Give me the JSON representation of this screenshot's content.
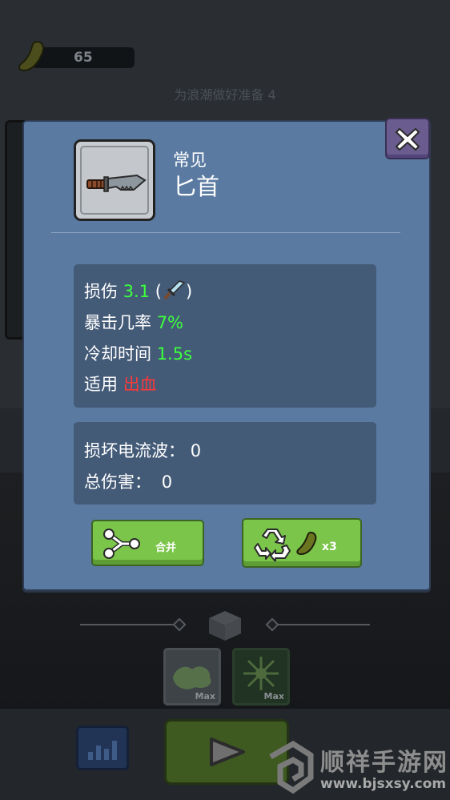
{
  "hud": {
    "currency_amount": "65",
    "wave_prompt": "为浪潮做好准备 4"
  },
  "item": {
    "rarity": "常见",
    "name": "匕首",
    "icon": "knife-icon"
  },
  "stats": {
    "damage_label": "损伤",
    "damage_value": "3.1",
    "damage_paren_open": "(",
    "damage_paren_close": ")",
    "crit_label": "暴击几率",
    "crit_value": "7%",
    "cooldown_label": "冷却时间",
    "cooldown_value": "1.5s",
    "applies_label": "适用",
    "applies_value": "出血"
  },
  "totals": {
    "destroyed_label": "损坏电流波：",
    "destroyed_value": "0",
    "total_damage_label": "总伤害：",
    "total_damage_value": "0"
  },
  "buttons": {
    "merge_label": "合并",
    "recycle_cost": "x3"
  },
  "upgrades": {
    "slot1_label": "Max",
    "slot2_label": "Max"
  },
  "watermark": {
    "title": "顺祥手游网",
    "url": "www.bjsxsy.com"
  },
  "colors": {
    "dialog_bg": "#5a7aa2",
    "panel_bg": "#445b78",
    "positive_green": "#3dff3d",
    "effect_red": "#ff3838",
    "button_green": "#7bc54a",
    "close_purple": "#6a5c8f"
  }
}
